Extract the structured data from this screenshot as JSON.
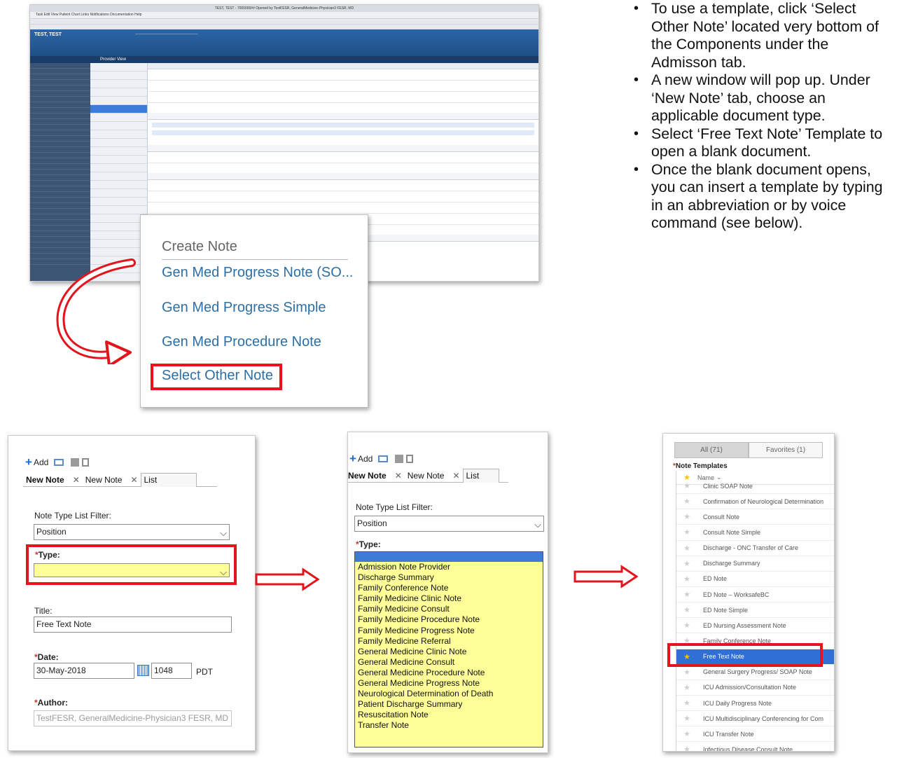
{
  "ehr": {
    "title": "TEST, TEST - 7000000## Opened by TestFESR, GeneralMedicine-Physician3 FESR, MD",
    "menu": "Task   Edit   View   Patient   Chart   Links   Notifications   Documentation   Help",
    "patient_name": "TEST, TEST",
    "nav_title": "Provider View"
  },
  "create_note": {
    "header": "Create Note",
    "items": [
      "Gen Med Progress Note (SO...",
      "Gen Med Progress Simple",
      "Gen Med Procedure Note",
      "Select Other Note"
    ]
  },
  "bullets": [
    "To use a template, click ‘Select Other Note’ located very bottom of the Components under the Admisson tab.",
    "A new window will pop up. Under ‘New Note’ tab, choose an applicable document type.",
    "Select ‘Free Text Note’ Template to open a blank document.",
    "Once the blank document opens, you can insert a template by typing in an abbreviation or by voice command (see below)."
  ],
  "panel1": {
    "add_label": "Add",
    "tabs": [
      "New Note",
      "New Note",
      "List"
    ],
    "filter_label": "Note Type List Filter:",
    "filter_value": "Position",
    "type_label": "Type:",
    "title_label": "Title:",
    "title_value": "Free Text Note",
    "date_label": "Date:",
    "date_value": "30-May-2018",
    "time_value": "1048",
    "timezone": "PDT",
    "author_label": "Author:",
    "author_value": "TestFESR, GeneralMedicine-Physician3 FESR, MD"
  },
  "panel2": {
    "add_label": "Add",
    "tabs": [
      "New Note",
      "New Note",
      "List"
    ],
    "filter_label": "Note Type List Filter:",
    "filter_value": "Position",
    "type_label": "Type:",
    "options": [
      "Admission Note Provider",
      "Discharge Summary",
      "Family Conference Note",
      "Family Medicine Clinic Note",
      "Family Medicine Consult",
      "Family Medicine Procedure Note",
      "Family Medicine Progress Note",
      "Family Medicine Referral",
      "General Medicine Clinic Note",
      "General Medicine Consult",
      "General Medicine Procedure Note",
      "General Medicine Progress Note",
      "Neurological Determination of Death",
      "Patient Discharge Summary",
      "Resuscitation Note",
      "Transfer Note"
    ]
  },
  "panel3": {
    "tab_all": "All (71)",
    "tab_favorites": "Favorites (1)",
    "title": "Note Templates",
    "name_header": "Name",
    "rows": [
      "Clinic SOAP Note",
      "Confirmation of Neurological Determination",
      "Consult Note",
      "Consult Note Simple",
      "Discharge - ONC Transfer of Care",
      "Discharge Summary",
      "ED Note",
      "ED Note – WorksafeBC",
      "ED Note Simple",
      "ED Nursing Assessment Note",
      "Family Conference Note",
      "Free Text Note",
      "General Surgery Progress/ SOAP Note",
      "ICU Admission/Consultation Note",
      "ICU Daily Progress Note",
      "ICU Multidisciplinary Conferencing for Com",
      "ICU Transfer Note",
      "Infectious Disease Consult Note"
    ],
    "selected": "Free Text Note"
  },
  "colors": {
    "highlight_red": "#e3141b",
    "selection_blue": "#2f6fd6",
    "field_yellow": "#ffff9a",
    "link_blue": "#2d6fa4"
  }
}
